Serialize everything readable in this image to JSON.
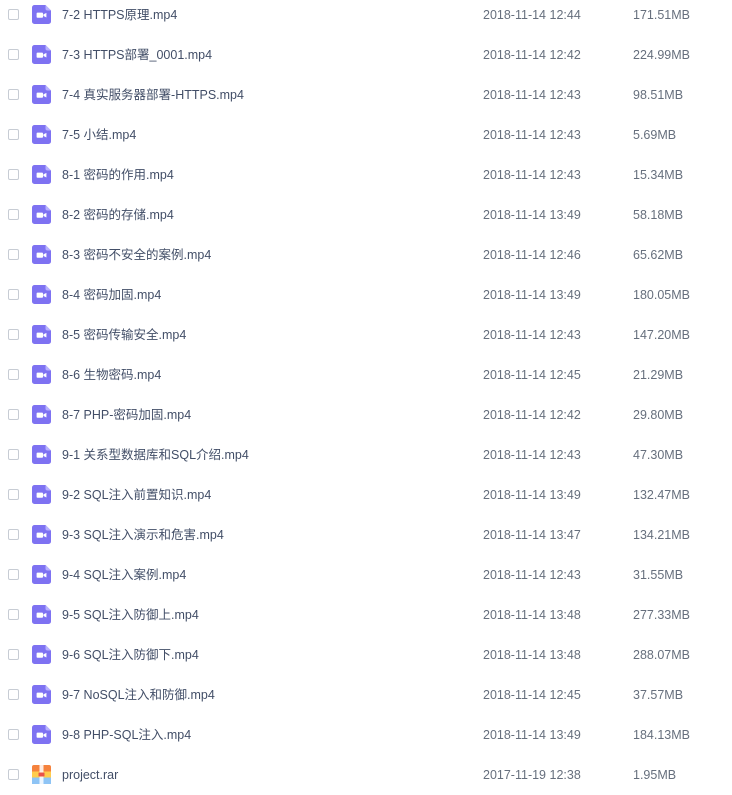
{
  "colors": {
    "video_icon": "#7e72f2",
    "archive_icon_primary": "#f5823d",
    "archive_icon_secondary": "#ffcc4d",
    "text": "#424e67",
    "meta_text": "#666f7d",
    "checkbox_border": "#c7ccd4"
  },
  "files": [
    {
      "name": "7-2 HTTPS原理.mp4",
      "date": "2018-11-14 12:44",
      "size": "171.51MB",
      "icon": "video-file-icon"
    },
    {
      "name": "7-3 HTTPS部署_0001.mp4",
      "date": "2018-11-14 12:42",
      "size": "224.99MB",
      "icon": "video-file-icon"
    },
    {
      "name": "7-4 真实服务器部署-HTTPS.mp4",
      "date": "2018-11-14 12:43",
      "size": "98.51MB",
      "icon": "video-file-icon"
    },
    {
      "name": "7-5 小结.mp4",
      "date": "2018-11-14 12:43",
      "size": "5.69MB",
      "icon": "video-file-icon"
    },
    {
      "name": "8-1 密码的作用.mp4",
      "date": "2018-11-14 12:43",
      "size": "15.34MB",
      "icon": "video-file-icon"
    },
    {
      "name": "8-2 密码的存储.mp4",
      "date": "2018-11-14 13:49",
      "size": "58.18MB",
      "icon": "video-file-icon"
    },
    {
      "name": "8-3 密码不安全的案例.mp4",
      "date": "2018-11-14 12:46",
      "size": "65.62MB",
      "icon": "video-file-icon"
    },
    {
      "name": "8-4 密码加固.mp4",
      "date": "2018-11-14 13:49",
      "size": "180.05MB",
      "icon": "video-file-icon"
    },
    {
      "name": "8-5 密码传输安全.mp4",
      "date": "2018-11-14 12:43",
      "size": "147.20MB",
      "icon": "video-file-icon"
    },
    {
      "name": "8-6 生物密码.mp4",
      "date": "2018-11-14 12:45",
      "size": "21.29MB",
      "icon": "video-file-icon"
    },
    {
      "name": "8-7 PHP-密码加固.mp4",
      "date": "2018-11-14 12:42",
      "size": "29.80MB",
      "icon": "video-file-icon"
    },
    {
      "name": "9-1 关系型数据库和SQL介绍.mp4",
      "date": "2018-11-14 12:43",
      "size": "47.30MB",
      "icon": "video-file-icon"
    },
    {
      "name": "9-2 SQL注入前置知识.mp4",
      "date": "2018-11-14 13:49",
      "size": "132.47MB",
      "icon": "video-file-icon"
    },
    {
      "name": "9-3 SQL注入演示和危害.mp4",
      "date": "2018-11-14 13:47",
      "size": "134.21MB",
      "icon": "video-file-icon"
    },
    {
      "name": "9-4 SQL注入案例.mp4",
      "date": "2018-11-14 12:43",
      "size": "31.55MB",
      "icon": "video-file-icon"
    },
    {
      "name": "9-5 SQL注入防御上.mp4",
      "date": "2018-11-14 13:48",
      "size": "277.33MB",
      "icon": "video-file-icon"
    },
    {
      "name": "9-6 SQL注入防御下.mp4",
      "date": "2018-11-14 13:48",
      "size": "288.07MB",
      "icon": "video-file-icon"
    },
    {
      "name": "9-7 NoSQL注入和防御.mp4",
      "date": "2018-11-14 12:45",
      "size": "37.57MB",
      "icon": "video-file-icon"
    },
    {
      "name": "9-8 PHP-SQL注入.mp4",
      "date": "2018-11-14 13:49",
      "size": "184.13MB",
      "icon": "video-file-icon"
    },
    {
      "name": "project.rar",
      "date": "2017-11-19 12:38",
      "size": "1.95MB",
      "icon": "archive-file-icon"
    }
  ]
}
